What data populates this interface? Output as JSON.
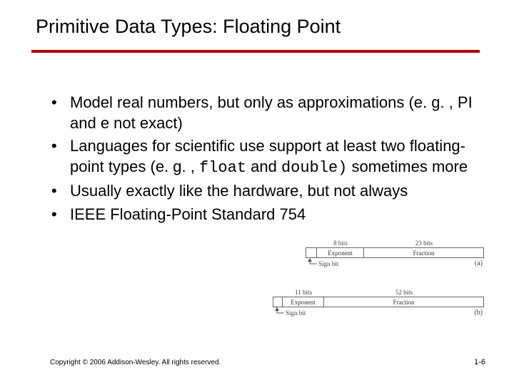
{
  "title": "Primitive Data Types: Floating Point",
  "bullets": {
    "b1": "Model real numbers, but only as approximations (e. g. , PI and e not exact)",
    "b2a": "Languages for scientific use support at least two floating-point types (e. g. , ",
    "b2_float": "float",
    "b2b": " and ",
    "b2_double": "double)",
    "b2c": " sometimes more",
    "b3": "Usually exactly like the hardware, but not always",
    "b4": "IEEE Floating-Point Standard 754"
  },
  "figure": {
    "small": {
      "bits_exp": "8 bits",
      "bits_frac": "23 bits",
      "exp": "Exponent",
      "frac": "Fraction",
      "sign": "Sign bit",
      "cap": "(a)"
    },
    "large": {
      "bits_exp": "11 bits",
      "bits_frac": "52 bits",
      "exp": "Exponent",
      "frac": "Fraction",
      "sign": "Sign bit",
      "cap": "(b)"
    }
  },
  "footer": {
    "copyright": "Copyright © 2006 Addison-Wesley. All rights reserved.",
    "pagenum": "1-6"
  }
}
